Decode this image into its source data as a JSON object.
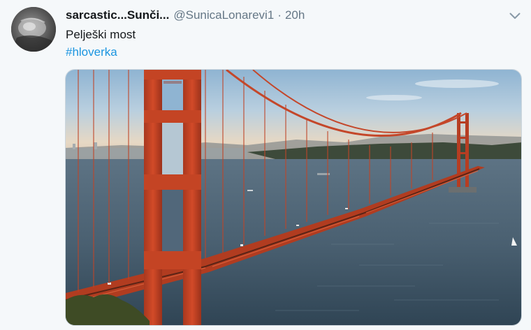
{
  "tweet": {
    "display_name": "sarcastic...Sunči...",
    "handle": "@SunicaLonarevi1",
    "separator": "·",
    "time": "20h",
    "text": "Pelješki most",
    "hashtag": "#hloverka"
  },
  "icons": {
    "avatar": "profile-photo",
    "menu": "chevron-down-icon"
  },
  "colors": {
    "link": "#1b95e0",
    "text": "#14171a",
    "secondary": "#657786",
    "background": "#f5f8fa"
  },
  "media": {
    "kind": "photo",
    "subject": "suspension-bridge"
  }
}
